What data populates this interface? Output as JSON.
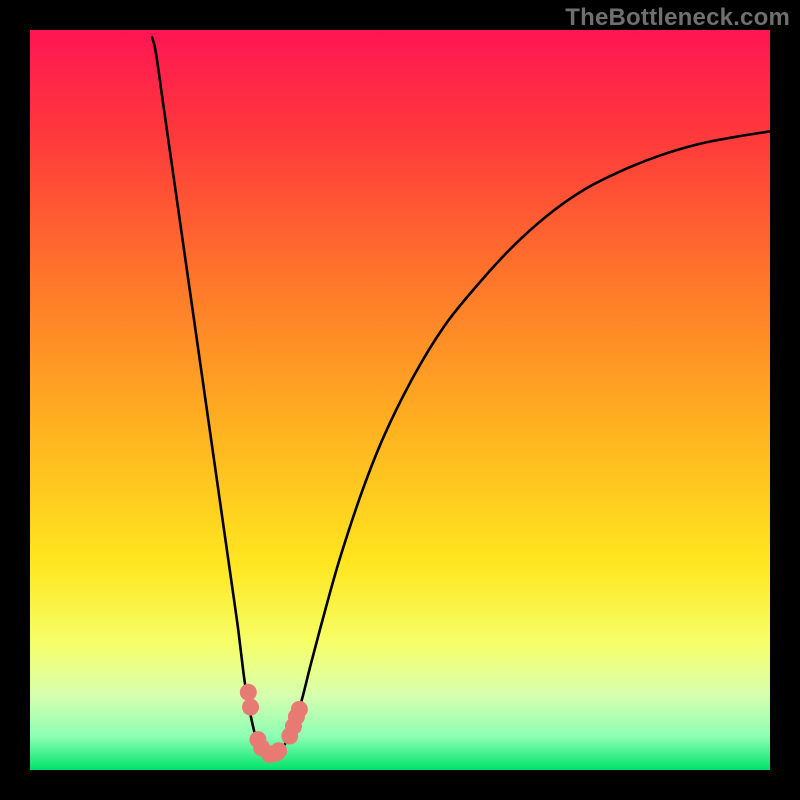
{
  "watermark": "TheBottleneck.com",
  "colors": {
    "black": "#000000",
    "curve": "#000000",
    "marker": "#e77b74",
    "gradient_stops": [
      {
        "offset": 0.0,
        "color": "#ff1552"
      },
      {
        "offset": 0.15,
        "color": "#ff3b3b"
      },
      {
        "offset": 0.35,
        "color": "#ff7a2a"
      },
      {
        "offset": 0.55,
        "color": "#ffb51f"
      },
      {
        "offset": 0.72,
        "color": "#ffe61f"
      },
      {
        "offset": 0.83,
        "color": "#f6ff6a"
      },
      {
        "offset": 0.9,
        "color": "#d6ffb0"
      },
      {
        "offset": 0.955,
        "color": "#8cffb3"
      },
      {
        "offset": 1.0,
        "color": "#00e36a"
      }
    ]
  },
  "chart_data": {
    "type": "line",
    "title": "",
    "xlabel": "",
    "ylabel": "",
    "xlim": [
      0,
      100
    ],
    "ylim": [
      0,
      100
    ],
    "x": [
      16.5,
      17,
      18,
      19,
      20,
      21,
      22,
      23,
      24,
      25,
      26,
      27,
      28,
      28.5,
      29,
      29.5,
      30,
      30.5,
      31,
      31.5,
      32,
      32.5,
      33,
      33.5,
      34,
      34.5,
      35.3,
      36.3,
      37,
      38,
      40,
      42,
      45,
      48,
      52,
      56,
      60,
      65,
      70,
      75,
      80,
      85,
      90,
      95,
      100
    ],
    "values": [
      99,
      97,
      90,
      83,
      76,
      69,
      62,
      55,
      48,
      41,
      34,
      27,
      20,
      16,
      12,
      9,
      6.5,
      4.5,
      3.2,
      2.4,
      2.0,
      2.0,
      2.1,
      2.3,
      2.8,
      3.6,
      5.2,
      8.0,
      10.5,
      14.5,
      22,
      29,
      38,
      45.5,
      53.5,
      60,
      65,
      70.5,
      75,
      78.5,
      81,
      83,
      84.5,
      85.5,
      86.3
    ],
    "markers": {
      "x": [
        29.5,
        29.8,
        30.8,
        31.3,
        32.4,
        32.9,
        33.3,
        33.6,
        35.1,
        35.6,
        36.0,
        36.4
      ],
      "values": [
        10.5,
        8.5,
        4.1,
        3.0,
        2.1,
        2.2,
        2.3,
        2.6,
        4.6,
        5.9,
        7.2,
        8.2
      ]
    },
    "legend": [],
    "grid": false
  }
}
